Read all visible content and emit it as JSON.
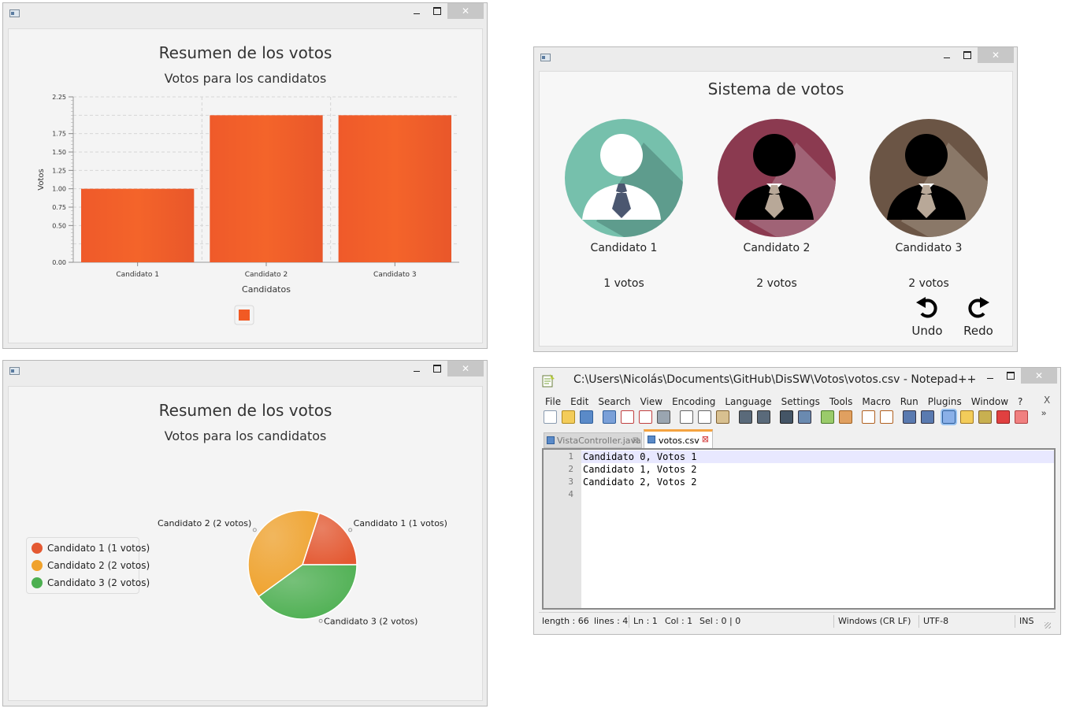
{
  "bar_window": {
    "title": "Resumen de los votos",
    "subtitle": "Votos para los candidatos"
  },
  "chart_data": [
    {
      "type": "bar",
      "title": "Resumen de los votos",
      "subtitle": "Votos para los candidatos",
      "categories": [
        "Candidato 1",
        "Candidato 2",
        "Candidato 3"
      ],
      "values": [
        1,
        2,
        2
      ],
      "xlabel": "Candidatos",
      "ylabel": "Votos",
      "ylim": [
        0,
        2.25
      ],
      "yticks": [
        "0.00",
        "0.50",
        "0.75",
        "1.00",
        "1.25",
        "1.50",
        "1.75",
        "2.25"
      ],
      "grid": true,
      "legend": "bottom",
      "color": "#f15a24"
    },
    {
      "type": "pie",
      "title": "Resumen de los votos",
      "subtitle": "Votos para los candidatos",
      "labels": [
        "Candidato 1 (1 votos)",
        "Candidato 2 (2 votos)",
        "Candidato 3 (2 votos)"
      ],
      "values": [
        1,
        2,
        2
      ],
      "colors": [
        "#e45932",
        "#f0a22c",
        "#4caf50"
      ],
      "legend": "left"
    }
  ],
  "pie_window": {
    "title": "Resumen de los votos",
    "subtitle": "Votos para los candidatos"
  },
  "vote_window": {
    "title": "Sistema de votos",
    "candidates": [
      {
        "name": "Candidato 1",
        "votes": "1 votos",
        "color": "#76c0ac"
      },
      {
        "name": "Candidato 2",
        "votes": "2 votos",
        "color": "#8b3a50"
      },
      {
        "name": "Candidato 3",
        "votes": "2 votos",
        "color": "#6b5545"
      }
    ],
    "undo_label": "Undo",
    "redo_label": "Redo"
  },
  "notepad": {
    "title": "C:\\Users\\Nicolás\\Documents\\GitHub\\DisSW\\Votos\\votos.csv - Notepad++",
    "menu": [
      "File",
      "Edit",
      "Search",
      "View",
      "Encoding",
      "Language",
      "Settings",
      "Tools",
      "Macro",
      "Run",
      "Plugins",
      "Window",
      "?"
    ],
    "menu_close": "X",
    "tabs": [
      "VistaController.java",
      "votos.csv"
    ],
    "line_numbers": [
      "1",
      "2",
      "3",
      "4"
    ],
    "lines": [
      "Candidato 0, Votos 1",
      "Candidato 1, Votos 2",
      "Candidato 2, Votos 2",
      ""
    ],
    "status": {
      "length": "length : 66",
      "lines": "lines : 4",
      "ln": "Ln : 1",
      "col": "Col : 1",
      "sel": "Sel : 0 | 0",
      "eol": "Windows (CR LF)",
      "encoding": "UTF-8",
      "mode": "INS"
    }
  }
}
